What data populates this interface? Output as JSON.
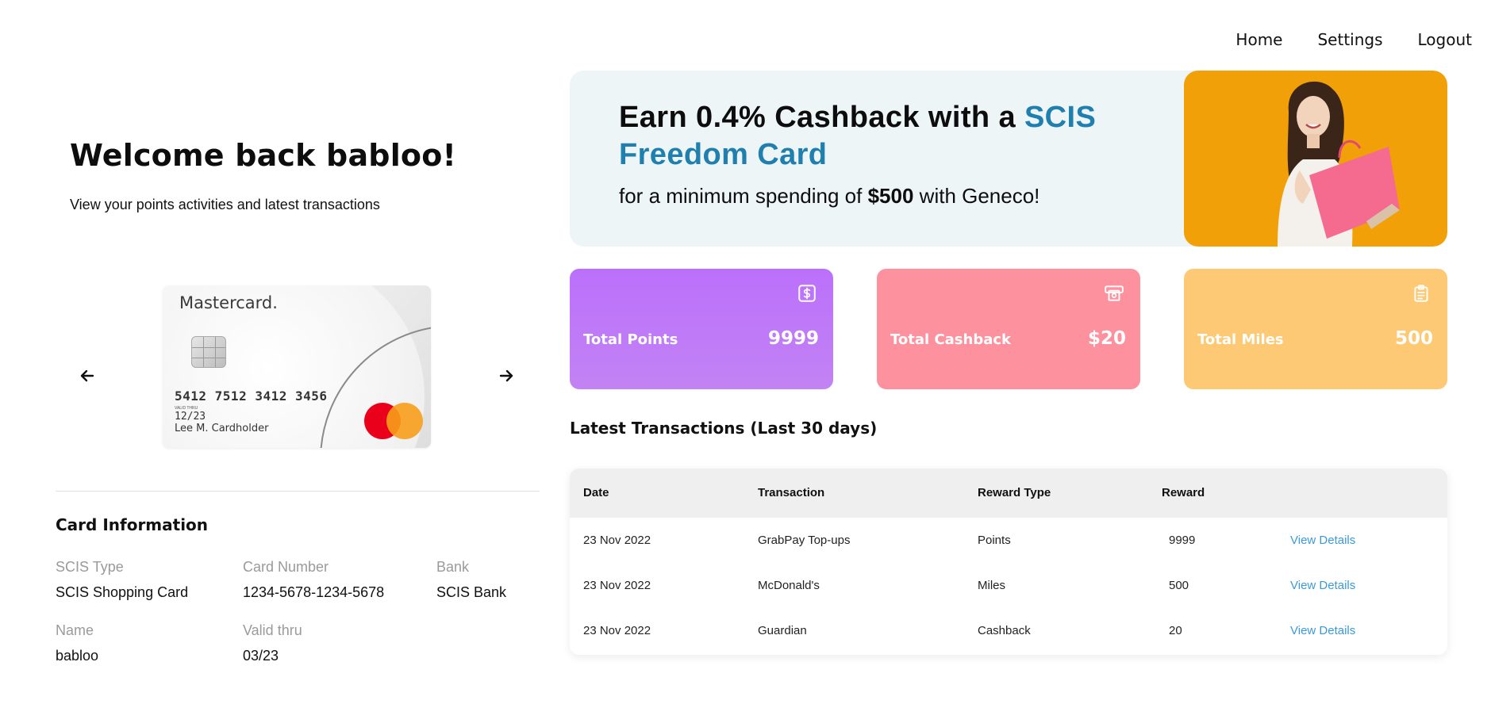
{
  "nav": {
    "home": "Home",
    "settings": "Settings",
    "logout": "Logout"
  },
  "welcome": {
    "title": "Welcome back babloo!",
    "subtitle": "View your points activities and latest transactions"
  },
  "card": {
    "brand": "Mastercard.",
    "number": "5412 7512 3412 3456",
    "valid_label": "VALID THRU",
    "expiry": "12/23",
    "holder": "Lee M. Cardholder"
  },
  "card_info": {
    "title": "Card Information",
    "scis_type_label": "SCIS Type",
    "scis_type": "SCIS Shopping Card",
    "card_number_label": "Card Number",
    "card_number": "1234-5678-1234-5678",
    "bank_label": "Bank",
    "bank": "SCIS Bank",
    "name_label": "Name",
    "name": "babloo",
    "valid_label": "Valid thru",
    "valid": "03/23"
  },
  "promo": {
    "head_part1": "Earn 0.4% Cashback with a ",
    "head_accent": "SCIS Freedom Card",
    "sub_part1": "for a minimum spending of ",
    "sub_amount": "$500",
    "sub_part2": " with Geneco!",
    "accent_color": "#1f7fae",
    "image_bg": "#f2a007"
  },
  "stats": {
    "points": {
      "label": "Total Points",
      "value": "9999",
      "icon": "dollar-icon",
      "color": "#bb70fb"
    },
    "cashback": {
      "label": "Total Cashback",
      "value": "$20",
      "icon": "atm-cash-icon",
      "color": "#fd919d"
    },
    "miles": {
      "label": "Total Miles",
      "value": "500",
      "icon": "clipboard-icon",
      "color": "#fdc974"
    }
  },
  "transactions": {
    "title": "Latest Transactions (Last 30 days)",
    "headers": [
      "Date",
      "Transaction",
      "Reward Type",
      "Reward"
    ],
    "rows": [
      {
        "date": "23 Nov 2022",
        "transaction": "GrabPay Top-ups",
        "reward_type": "Points",
        "reward": "9999",
        "link": "View Details"
      },
      {
        "date": "23 Nov 2022",
        "transaction": "McDonald's",
        "reward_type": "Miles",
        "reward": "500",
        "link": "View Details"
      },
      {
        "date": "23 Nov 2022",
        "transaction": "Guardian",
        "reward_type": "Cashback",
        "reward": "20",
        "link": "View Details"
      }
    ],
    "link_color": "#3a9ad9"
  }
}
